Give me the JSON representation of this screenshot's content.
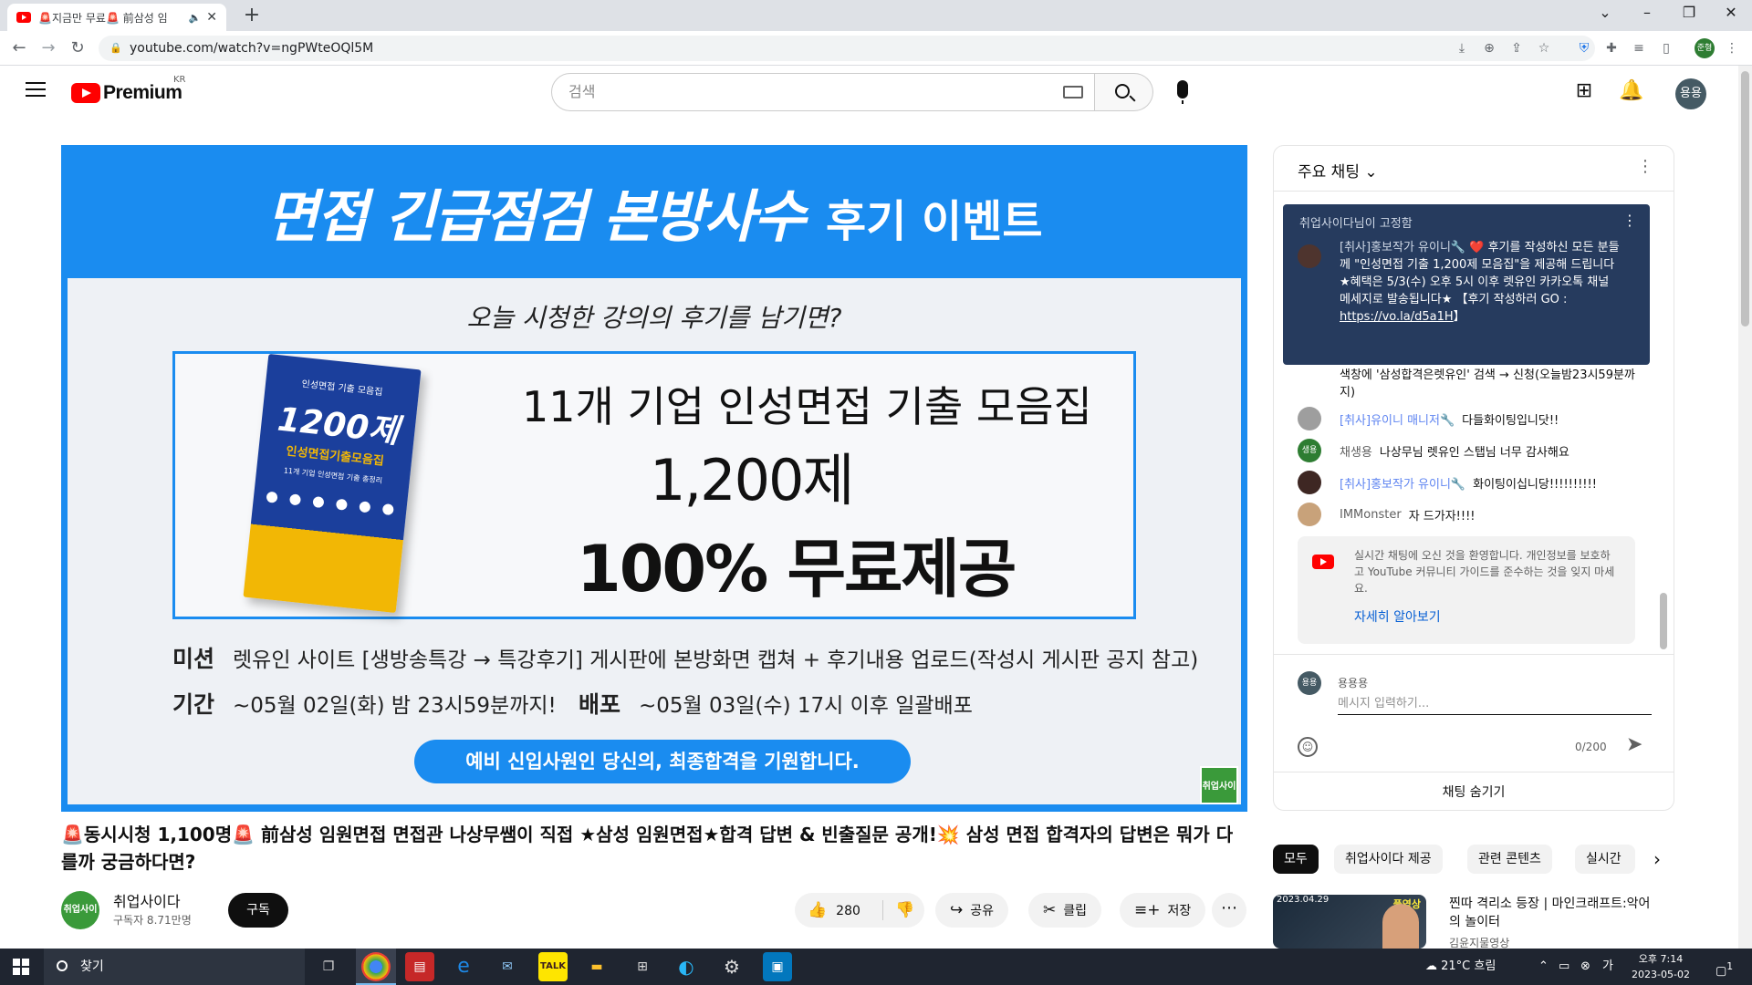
{
  "browser": {
    "tab_title": "🚨지금만 무료🚨 前삼성 임",
    "url": "youtube.com/watch?v=ngPWteOQl5M",
    "profile_initials": "준형"
  },
  "masthead": {
    "logo_text": "Premium",
    "region": "KR",
    "search_placeholder": "검색",
    "avatar_initials": "용용"
  },
  "video": {
    "headline": "면접 긴급점검 본방사수",
    "headline_sub": "후기 이벤트",
    "question": "오늘 시청한 강의의 후기를 남기면?",
    "book_top": "인성면접 기출 모음집",
    "book_title": "1200제",
    "book_subtitle": "인성면접기출모음집",
    "book_small": "11개 기업 인성면접 기출 총정리",
    "offer_line1": "11개 기업 인성면접 기출 모음집",
    "offer_line2": "1,200제",
    "offer_line3": "100% 무료제공",
    "mission_label": "미션",
    "mission_text": "렛유인 사이트 [생방송특강 → 특강후기] 게시판에 본방화면 캡쳐 + 후기내용 업로드(작성시 게시판 공지 참고)",
    "period_label": "기간",
    "period_text": "~05월 02일(화) 밤 23시59분까지!",
    "dist_label": "배포",
    "dist_text": "~05월 03일(수) 17시 이후 일괄배포",
    "pill_text": "예비 신입사원인 당신의, 최종합격을 기원합니다.",
    "badge": "취업사이다"
  },
  "meta": {
    "title": "🚨동시시청 1,100명🚨 前삼성 임원면접 면접관 나상무쌤이 직접 ★삼성 임원면접★합격 답변 & 빈출질문 공개!💥 삼성 면접 합격자의 답변은 뭐가 다를까 궁금하다면?",
    "channel_name": "취업사이다",
    "channel_subs": "구독자 8.71만명",
    "channel_avatar": "취업사이다",
    "subscribe": "구독",
    "likes": "280",
    "share": "공유",
    "clip": "클립",
    "save": "저장"
  },
  "chat": {
    "mode": "주요 채팅",
    "pinned_by": "취업사이다님이 고정함",
    "pinned_author": "[취사]홍보작가 유이니🔧",
    "pinned_text": "❤️ 후기를 작성하신 모든 분들께 \"인성면접 기출 1,200제 모음집\"을 제공해 드립니다 ★혜택은 5/3(수) 오후 5시 이후 렛유인 카카오톡 채널 메세지로 발송됩니다★ 【후기 작성하러 GO : ",
    "pinned_link": "https://vo.la/d5a1H",
    "pinned_end": "】",
    "pinned_tail": "색창에 '삼성합격은렛유인' 검색 → 신청(오늘밤23시59분까지)",
    "messages": [
      {
        "author": "[취사]유이니 매니저🔧",
        "text": "다들화이팅입니닷!!",
        "mod": true,
        "color": "#9e9e9e",
        "initials": ""
      },
      {
        "author": "채생용",
        "text": "나상무님 렛유인 스탭님 너무 감사해요",
        "mod": false,
        "color": "#2e7d32",
        "initials": "생용"
      },
      {
        "author": "[취사]홍보작가 유이니🔧",
        "text": "화이팅이십니당!!!!!!!!!!",
        "mod": true,
        "color": "#3e2723",
        "initials": ""
      },
      {
        "author": "IMMonster",
        "text": "자 드가자!!!!",
        "mod": false,
        "color": "#c8a27a",
        "initials": ""
      }
    ],
    "welcome_text": "실시간 채팅에 오신 것을 환영합니다. 개인정보를 보호하고 YouTube 커뮤니티 가이드를 준수하는 것을 잊지 마세요.",
    "welcome_link": "자세히 알아보기",
    "input_name": "용용용",
    "input_avatar": "용용",
    "input_placeholder": "메시지 입력하기...",
    "char_count": "0/200",
    "hide_chat": "채팅 숨기기"
  },
  "chips": [
    "모두",
    "취업사이다 제공",
    "관련 콘텐츠",
    "실시간"
  ],
  "recommendation": {
    "date": "2023.04.29",
    "tag": "풀영상",
    "title": "찐따 격리소 등장 | 마인크래프트:악어의 놀이터",
    "channel": "김윤지물영상"
  },
  "taskbar": {
    "search": "찾기",
    "weather": "21°C 흐림",
    "time": "오후 7:14",
    "date": "2023-05-02",
    "notify_count": "1"
  }
}
